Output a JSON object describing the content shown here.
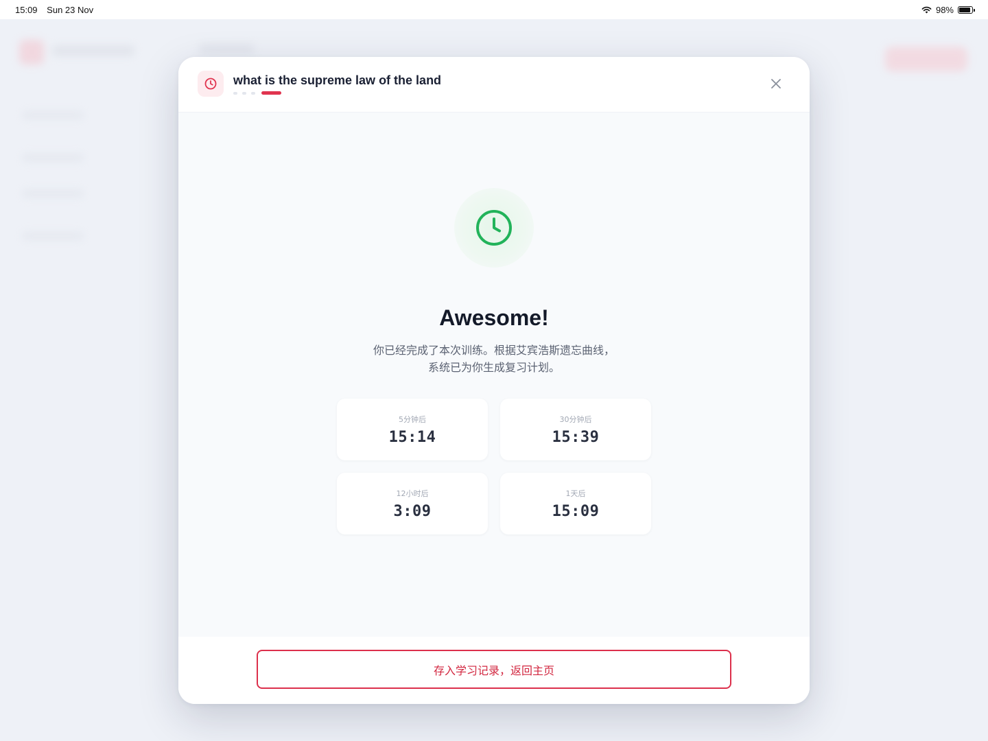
{
  "status_bar": {
    "time": "15:09",
    "date": "Sun 23 Nov",
    "battery": "98%"
  },
  "modal": {
    "title": "what is the supreme law of the land",
    "progress": {
      "total_steps": 4,
      "current_step": 4
    },
    "headline": "Awesome!",
    "message_line1": "你已经完成了本次训练。根据艾宾浩斯遗忘曲线，",
    "message_line2": "系统已为你生成复习计划。",
    "schedule": [
      {
        "label": "5分钟后",
        "time": "15:14"
      },
      {
        "label": "30分钟后",
        "time": "15:39"
      },
      {
        "label": "12小时后",
        "time": "3:09"
      },
      {
        "label": "1天后",
        "time": "15:09"
      }
    ],
    "save_button_label": "存入学习记录，返回主页"
  },
  "icons": {
    "header": "clock-icon",
    "hero": "clock-icon",
    "close": "close-icon",
    "wifi": "wifi-icon",
    "battery": "battery-icon"
  },
  "colors": {
    "accent": "#e0344f",
    "success": "#22b35a",
    "headline": "#141a29"
  }
}
